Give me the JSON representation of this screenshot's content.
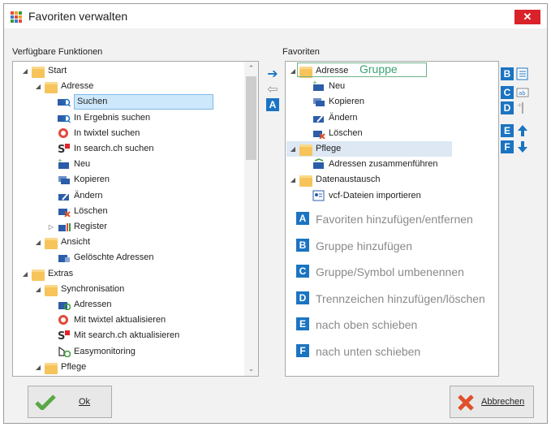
{
  "window": {
    "title": "Favoriten verwalten",
    "close_glyph": "✕"
  },
  "left_panel": {
    "label": "Verfügbare Funktionen",
    "items": [
      {
        "label": "Start",
        "icon": "folder-icon",
        "arrow": "◢",
        "indent": 0
      },
      {
        "label": "Adresse",
        "icon": "folder-icon",
        "arrow": "◢",
        "indent": 1
      },
      {
        "label": "Suchen",
        "icon": "address-search-icon",
        "arrow": "",
        "indent": 2,
        "selected": true
      },
      {
        "label": "In Ergebnis suchen",
        "icon": "address-search-icon",
        "arrow": "",
        "indent": 2
      },
      {
        "label": "In twixtel suchen",
        "icon": "twixtel-icon",
        "arrow": "",
        "indent": 2
      },
      {
        "label": "In search.ch suchen",
        "icon": "search-ch-icon",
        "arrow": "",
        "indent": 2
      },
      {
        "label": "Neu",
        "icon": "address-new-icon",
        "arrow": "",
        "indent": 2
      },
      {
        "label": "Kopieren",
        "icon": "address-copy-icon",
        "arrow": "",
        "indent": 2
      },
      {
        "label": "Ändern",
        "icon": "address-edit-icon",
        "arrow": "",
        "indent": 2
      },
      {
        "label": "Löschen",
        "icon": "address-delete-icon",
        "arrow": "",
        "indent": 2
      },
      {
        "label": "Register",
        "icon": "register-icon",
        "arrow": "▷",
        "indent": 2
      },
      {
        "label": "Ansicht",
        "icon": "folder-icon",
        "arrow": "◢",
        "indent": 1
      },
      {
        "label": "Gelöschte Adressen",
        "icon": "address-icon",
        "arrow": "",
        "indent": 2
      },
      {
        "label": "Extras",
        "icon": "folder-icon",
        "arrow": "◢",
        "indent": 0
      },
      {
        "label": "Synchronisation",
        "icon": "folder-icon",
        "arrow": "◢",
        "indent": 1
      },
      {
        "label": "Adressen",
        "icon": "address-sync-icon",
        "arrow": "",
        "indent": 2
      },
      {
        "label": "Mit twixtel aktualisieren",
        "icon": "twixtel-icon",
        "arrow": "",
        "indent": 2
      },
      {
        "label": "Mit search.ch aktualisieren",
        "icon": "search-ch-icon",
        "arrow": "",
        "indent": 2
      },
      {
        "label": "Easymonitoring",
        "icon": "monitoring-icon",
        "arrow": "",
        "indent": 2
      },
      {
        "label": "Pflege",
        "icon": "folder-icon",
        "arrow": "◢",
        "indent": 1
      }
    ]
  },
  "middle": {
    "add_glyph": "➔",
    "remove_glyph": "⇦",
    "badge": "A"
  },
  "right_panel": {
    "label": "Favoriten",
    "gruppe_annotation": "Gruppe",
    "items": [
      {
        "label": "Adresse",
        "icon": "folder-icon",
        "arrow": "◢",
        "indent": 0,
        "selected": true
      },
      {
        "label": "Neu",
        "icon": "address-new-icon",
        "arrow": "",
        "indent": 1
      },
      {
        "label": "Kopieren",
        "icon": "address-copy-icon",
        "arrow": "",
        "indent": 1
      },
      {
        "label": "Ändern",
        "icon": "address-edit-icon",
        "arrow": "",
        "indent": 1
      },
      {
        "label": "Löschen",
        "icon": "address-delete-icon",
        "arrow": "",
        "indent": 1
      },
      {
        "label": "Pflege",
        "icon": "folder-icon",
        "arrow": "◢",
        "indent": 0,
        "highlighted": true
      },
      {
        "label": "Adressen zusammenführen",
        "icon": "address-merge-icon",
        "arrow": "",
        "indent": 1
      },
      {
        "label": "Datenaustausch",
        "icon": "folder-icon",
        "arrow": "◢",
        "indent": 0
      },
      {
        "label": "vcf-Dateien importieren",
        "icon": "vcf-icon",
        "arrow": "",
        "indent": 1
      }
    ]
  },
  "side_buttons": [
    {
      "badge": "B",
      "icon": "add-group-icon"
    },
    {
      "badge": "C",
      "icon": "rename-icon"
    },
    {
      "badge": "D",
      "icon": "separator-icon"
    },
    {
      "badge": "E",
      "icon": "arrow-up-icon"
    },
    {
      "badge": "F",
      "icon": "arrow-down-icon"
    }
  ],
  "legend": [
    {
      "badge": "A",
      "text": "Favoriten hinzufügen/entfernen"
    },
    {
      "badge": "B",
      "text": "Gruppe hinzufügen"
    },
    {
      "badge": "C",
      "text": "Gruppe/Symbol umbenennen"
    },
    {
      "badge": "D",
      "text": "Trennzeichen hinzufügen/löschen"
    },
    {
      "badge": "E",
      "text": "nach oben schieben"
    },
    {
      "badge": "F",
      "text": "nach unten schieben"
    }
  ],
  "buttons": {
    "ok": "Ok",
    "cancel": "Abbrechen"
  },
  "colors": {
    "badge": "#1b74c2",
    "close": "#d9222a",
    "selection": "#cde8fb",
    "annotation": "#3aa373"
  }
}
